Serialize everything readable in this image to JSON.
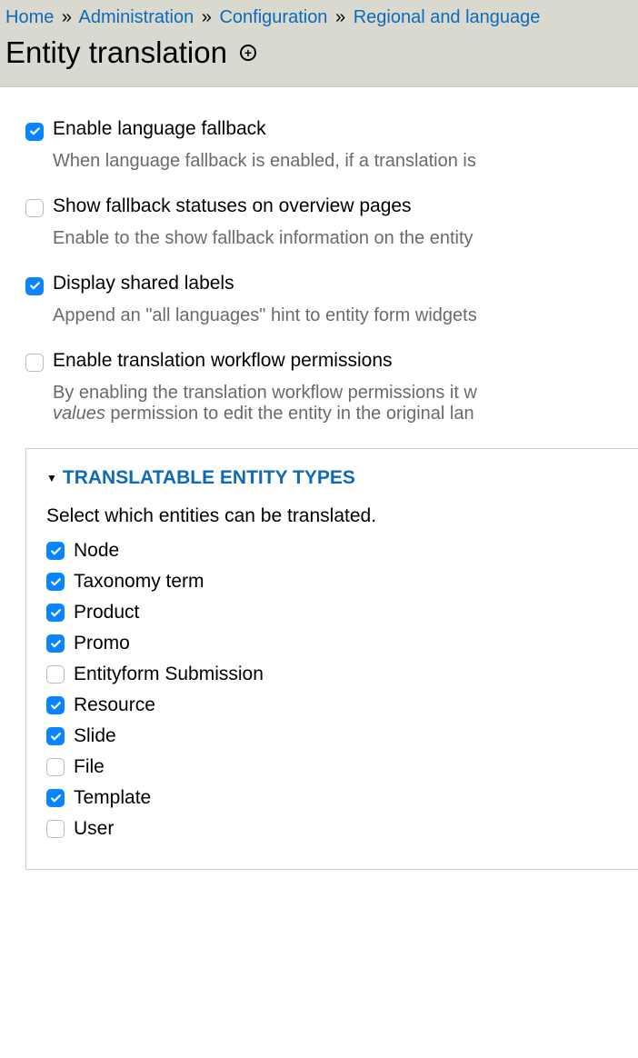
{
  "breadcrumb": {
    "items": [
      "Home",
      "Administration",
      "Configuration",
      "Regional and language"
    ],
    "separator": "»"
  },
  "page_title": "Entity translation",
  "options": [
    {
      "checked": true,
      "label": "Enable language fallback",
      "desc": "When language fallback is enabled, if a translation is"
    },
    {
      "checked": false,
      "label": "Show fallback statuses on overview pages",
      "desc": "Enable to the show fallback information on the entity"
    },
    {
      "checked": true,
      "label": "Display shared labels",
      "desc": "Append an \"all languages\" hint to entity form widgets"
    },
    {
      "checked": false,
      "label": "Enable translation workflow permissions",
      "desc_pre": "By enabling the translation workflow permissions it w",
      "desc_ital": "values",
      "desc_post": " permission to edit the entity in the original lan"
    }
  ],
  "fieldset": {
    "legend": "Translatable entity types",
    "desc": "Select which entities can be translated.",
    "entities": [
      {
        "checked": true,
        "label": "Node"
      },
      {
        "checked": true,
        "label": "Taxonomy term"
      },
      {
        "checked": true,
        "label": "Product"
      },
      {
        "checked": true,
        "label": "Promo"
      },
      {
        "checked": false,
        "label": "Entityform Submission"
      },
      {
        "checked": true,
        "label": "Resource"
      },
      {
        "checked": true,
        "label": "Slide"
      },
      {
        "checked": false,
        "label": "File"
      },
      {
        "checked": true,
        "label": "Template"
      },
      {
        "checked": false,
        "label": "User"
      }
    ]
  }
}
